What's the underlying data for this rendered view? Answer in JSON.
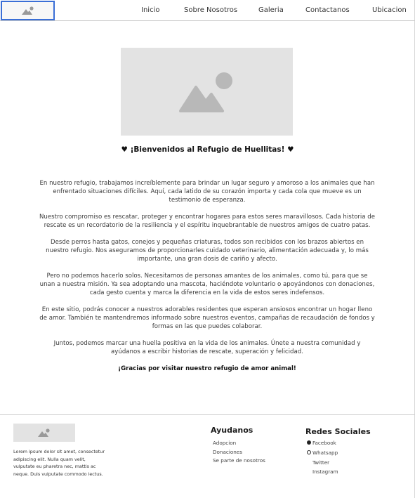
{
  "header": {
    "logo_icon": "image-placeholder-icon",
    "nav": [
      "Inicio",
      "Sobre Nosotros",
      "Galeria",
      "Contactanos",
      "Ubicacion"
    ]
  },
  "hero": {
    "image_icon": "image-placeholder-icon",
    "welcome": "♥ ¡Bienvenidos al Refugio de Huellitas! ♥"
  },
  "main": {
    "paragraphs": [
      "En nuestro refugio, trabajamos increíblemente para brindar un lugar seguro y amoroso a los animales que han enfrentado situaciones difíciles. Aquí, cada latido de su corazón importa y cada cola que mueve es un testimonio de esperanza.",
      "Nuestro compromiso es rescatar, proteger y encontrar hogares para estos seres maravillosos. Cada historia de rescate es un recordatorio de la resiliencia y el espíritu inquebrantable de nuestros amigos de cuatro patas.",
      "Desde perros hasta gatos, conejos y pequeñas criaturas, todos son recibidos con los brazos abiertos en nuestro refugio. Nos aseguramos de proporcionarles cuidado veterinario, alimentación adecuada y, lo más importante, una gran dosis de cariño y afecto.",
      "Pero no podemos hacerlo solos. Necesitamos de personas amantes de los animales, como tú, para que se unan a nuestra misión. Ya sea adoptando una mascota, haciéndote voluntario o apoyándonos con donaciones, cada gesto cuenta y marca la diferencia en la vida de estos seres indefensos.",
      "En este sitio, podrás conocer a nuestros adorables residentes que esperan ansiosos encontrar un hogar lleno de amor. También te mantendremos informado sobre nuestros eventos, campañas de recaudación de fondos y formas en las que puedes colaborar.",
      "Juntos, podemos marcar una huella positiva en la vida de los animales. Únete a nuestra comunidad y ayúdanos a escribir historias de rescate, superación y felicidad."
    ],
    "thanks": "¡Gracias por visitar nuestro refugio de amor animal!"
  },
  "footer": {
    "logo_icon": "image-placeholder-icon",
    "lorem": "Lorem ipsum dolor sit amet, consectetur adipiscing elit. Nulla quam velit, vulputate eu pharetra nec, mattis ac neque. Duis vulputate commodo lectus.",
    "help": {
      "title": "Ayudanos",
      "links": [
        "Adopcion",
        "Donaciones",
        "Se parte de nosotros"
      ]
    },
    "social": {
      "title": "Redes Sociales",
      "links": [
        "Facebook",
        "Whatsapp",
        "Twitter",
        "Instagram"
      ],
      "icons": [
        "facebook-icon",
        "whatsapp-icon"
      ]
    }
  }
}
